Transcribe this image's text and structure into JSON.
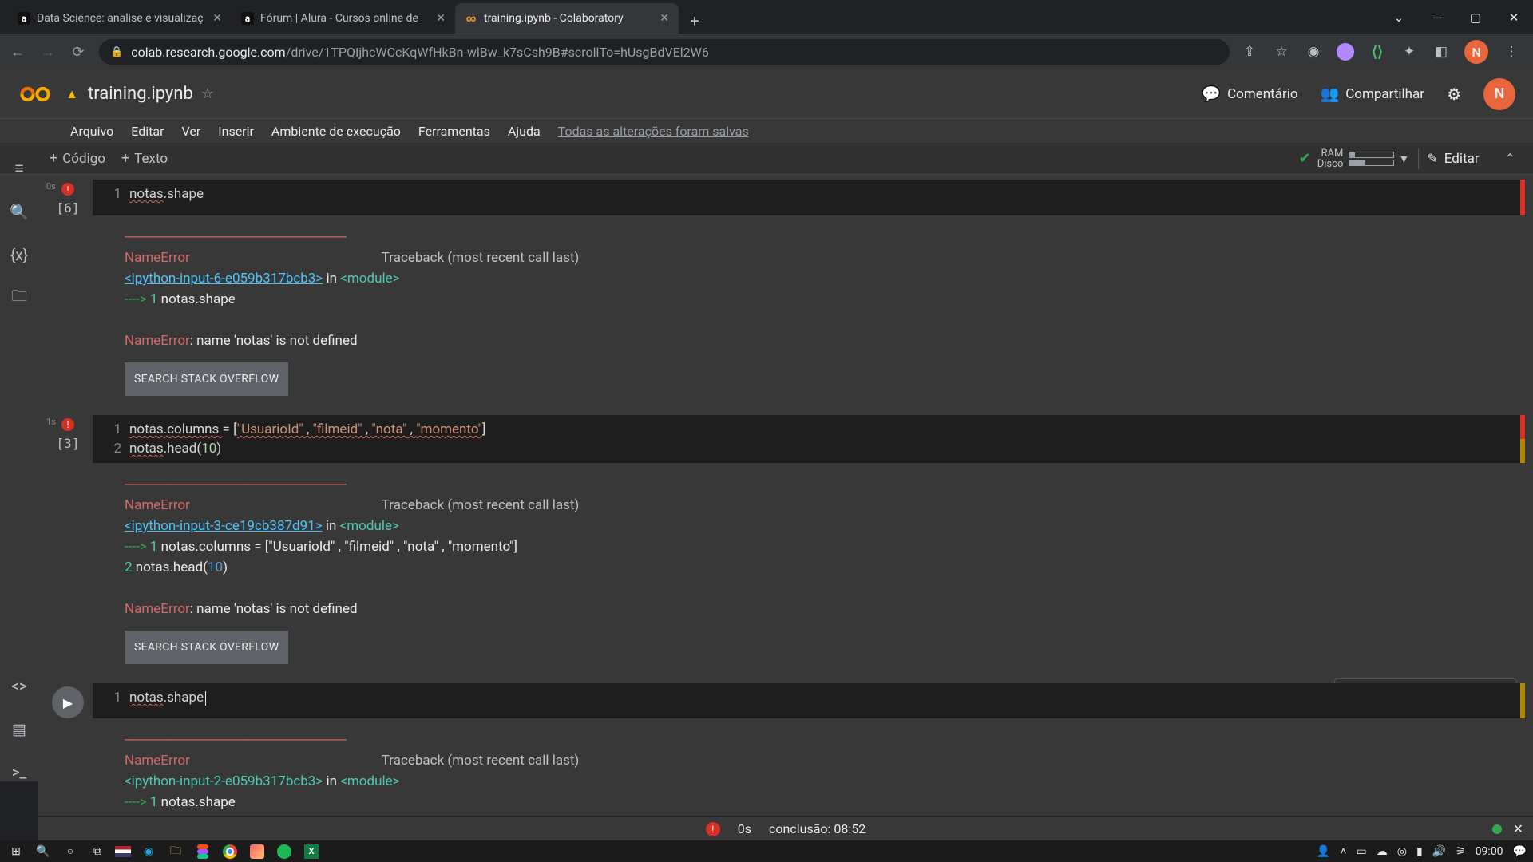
{
  "tabs": [
    {
      "title": "Data Science: analise e visualizaç"
    },
    {
      "title": "Fórum | Alura - Cursos online de"
    },
    {
      "title": "training.ipynb - Colaboratory"
    }
  ],
  "url": {
    "host": "colab.research.google.com",
    "path": "/drive/1TPQIjhcWCcKqWfHkBn-wlBw_k7sCsh9B#scrollTo=hUsgBdVEl2W6"
  },
  "doc": {
    "title": "training.ipynb",
    "avatar": "N"
  },
  "header": {
    "comment": "Comentário",
    "share": "Compartilhar"
  },
  "menu": {
    "file": "Arquivo",
    "edit": "Editar",
    "view": "Ver",
    "insert": "Inserir",
    "runtime": "Ambiente de execução",
    "tools": "Ferramentas",
    "help": "Ajuda",
    "save": "Todas as alterações foram salvas"
  },
  "actions": {
    "code": "Código",
    "text": "Texto",
    "edit": "Editar"
  },
  "resources": {
    "ram": "RAM",
    "disk": "Disco"
  },
  "cells": {
    "c1": {
      "exec": "[6]",
      "elapsed": "0s",
      "ln": "1",
      "code_a": "notas",
      "code_b": ".shape"
    },
    "c2": {
      "exec": "[3]",
      "elapsed": "1s",
      "ln1": "1",
      "ln2": "2",
      "p1": "notas.columns ",
      "eq": "=",
      "sp": " ",
      "br_o": "[",
      "s1": "\"UsuarioId\"",
      "c": " , ",
      "s2": "\"filmeid\"",
      "s3": "\"nota\"",
      "s4": "\"momento\"",
      "br_c": "]",
      "l2a": "notas",
      "l2b": ".head(",
      "l2n": "10",
      "l2c": ")"
    },
    "c3": {
      "ln": "1",
      "code_a": "notas",
      "code_b": ".shape"
    }
  },
  "out": {
    "dashes": "---------------------------------------------------------------------------",
    "name": "NameError",
    "trace": "Traceback (most recent call last)",
    "lnk1": "<ipython-input-6-e059b317bcb3>",
    "lnk2": "<ipython-input-3-ce19cb387d91>",
    "lnk3": "<ipython-input-2-e059b317bcb3>",
    "in": " in ",
    "mod": "<module>",
    "arrow": "----> ",
    "one": "1",
    "two": "2",
    "t1": " notas.shape",
    "t2": " notas.columns = [\"UsuarioId\" , \"filmeid\" , \"nota\" , \"momento\"]",
    "t3": "      ",
    "t3b": " notas.head(",
    "t3n": "10",
    "t3c": ")",
    "msg": ": name 'notas' is not defined",
    "so": "SEARCH STACK OVERFLOW"
  },
  "status": {
    "time": "0s",
    "done": "conclusão: 08:52"
  },
  "clock": "09:00"
}
